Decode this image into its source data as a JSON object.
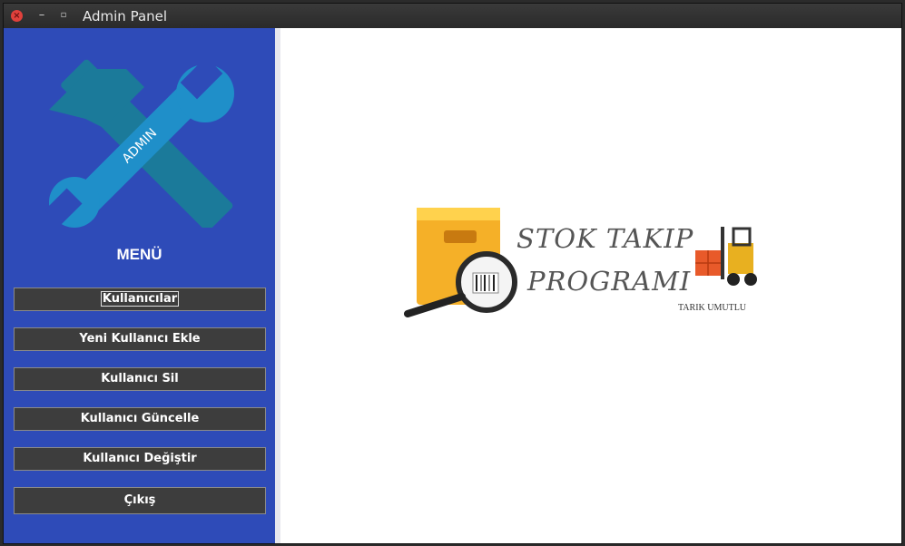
{
  "window": {
    "title": "Admin Panel",
    "close_glyph": "×",
    "min_glyph": "–",
    "max_glyph": "▫"
  },
  "sidebar": {
    "logo_text": "ADMIN",
    "menu_title": "MENÜ",
    "buttons": [
      {
        "label": "Kullanıcılar"
      },
      {
        "label": "Yeni Kullanıcı Ekle"
      },
      {
        "label": "Kullanıcı Sil"
      },
      {
        "label": "Kullanıcı Güncelle"
      },
      {
        "label": "Kullanıcı Değiştir"
      },
      {
        "label": "Çıkış"
      }
    ]
  },
  "content": {
    "title_line1": "STOK TAKIP",
    "title_line2": "PROGRAMI",
    "author": "TARIK UMUTLU"
  },
  "colors": {
    "sidebar_bg": "#2e4bb8",
    "button_bg": "#3d3d3d",
    "logo_wrench": "#1f8fc9",
    "logo_hammer": "#1b7a9a"
  }
}
